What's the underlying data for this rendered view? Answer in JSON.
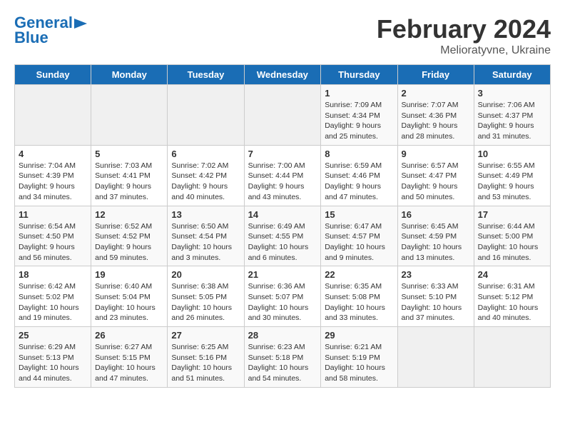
{
  "header": {
    "logo_line1": "General",
    "logo_line2": "Blue",
    "main_title": "February 2024",
    "sub_title": "Melioratyvne, Ukraine"
  },
  "columns": [
    "Sunday",
    "Monday",
    "Tuesday",
    "Wednesday",
    "Thursday",
    "Friday",
    "Saturday"
  ],
  "weeks": [
    [
      {
        "day": "",
        "content": ""
      },
      {
        "day": "",
        "content": ""
      },
      {
        "day": "",
        "content": ""
      },
      {
        "day": "",
        "content": ""
      },
      {
        "day": "1",
        "content": "Sunrise: 7:09 AM\nSunset: 4:34 PM\nDaylight: 9 hours\nand 25 minutes."
      },
      {
        "day": "2",
        "content": "Sunrise: 7:07 AM\nSunset: 4:36 PM\nDaylight: 9 hours\nand 28 minutes."
      },
      {
        "day": "3",
        "content": "Sunrise: 7:06 AM\nSunset: 4:37 PM\nDaylight: 9 hours\nand 31 minutes."
      }
    ],
    [
      {
        "day": "4",
        "content": "Sunrise: 7:04 AM\nSunset: 4:39 PM\nDaylight: 9 hours\nand 34 minutes."
      },
      {
        "day": "5",
        "content": "Sunrise: 7:03 AM\nSunset: 4:41 PM\nDaylight: 9 hours\nand 37 minutes."
      },
      {
        "day": "6",
        "content": "Sunrise: 7:02 AM\nSunset: 4:42 PM\nDaylight: 9 hours\nand 40 minutes."
      },
      {
        "day": "7",
        "content": "Sunrise: 7:00 AM\nSunset: 4:44 PM\nDaylight: 9 hours\nand 43 minutes."
      },
      {
        "day": "8",
        "content": "Sunrise: 6:59 AM\nSunset: 4:46 PM\nDaylight: 9 hours\nand 47 minutes."
      },
      {
        "day": "9",
        "content": "Sunrise: 6:57 AM\nSunset: 4:47 PM\nDaylight: 9 hours\nand 50 minutes."
      },
      {
        "day": "10",
        "content": "Sunrise: 6:55 AM\nSunset: 4:49 PM\nDaylight: 9 hours\nand 53 minutes."
      }
    ],
    [
      {
        "day": "11",
        "content": "Sunrise: 6:54 AM\nSunset: 4:50 PM\nDaylight: 9 hours\nand 56 minutes."
      },
      {
        "day": "12",
        "content": "Sunrise: 6:52 AM\nSunset: 4:52 PM\nDaylight: 9 hours\nand 59 minutes."
      },
      {
        "day": "13",
        "content": "Sunrise: 6:50 AM\nSunset: 4:54 PM\nDaylight: 10 hours\nand 3 minutes."
      },
      {
        "day": "14",
        "content": "Sunrise: 6:49 AM\nSunset: 4:55 PM\nDaylight: 10 hours\nand 6 minutes."
      },
      {
        "day": "15",
        "content": "Sunrise: 6:47 AM\nSunset: 4:57 PM\nDaylight: 10 hours\nand 9 minutes."
      },
      {
        "day": "16",
        "content": "Sunrise: 6:45 AM\nSunset: 4:59 PM\nDaylight: 10 hours\nand 13 minutes."
      },
      {
        "day": "17",
        "content": "Sunrise: 6:44 AM\nSunset: 5:00 PM\nDaylight: 10 hours\nand 16 minutes."
      }
    ],
    [
      {
        "day": "18",
        "content": "Sunrise: 6:42 AM\nSunset: 5:02 PM\nDaylight: 10 hours\nand 19 minutes."
      },
      {
        "day": "19",
        "content": "Sunrise: 6:40 AM\nSunset: 5:04 PM\nDaylight: 10 hours\nand 23 minutes."
      },
      {
        "day": "20",
        "content": "Sunrise: 6:38 AM\nSunset: 5:05 PM\nDaylight: 10 hours\nand 26 minutes."
      },
      {
        "day": "21",
        "content": "Sunrise: 6:36 AM\nSunset: 5:07 PM\nDaylight: 10 hours\nand 30 minutes."
      },
      {
        "day": "22",
        "content": "Sunrise: 6:35 AM\nSunset: 5:08 PM\nDaylight: 10 hours\nand 33 minutes."
      },
      {
        "day": "23",
        "content": "Sunrise: 6:33 AM\nSunset: 5:10 PM\nDaylight: 10 hours\nand 37 minutes."
      },
      {
        "day": "24",
        "content": "Sunrise: 6:31 AM\nSunset: 5:12 PM\nDaylight: 10 hours\nand 40 minutes."
      }
    ],
    [
      {
        "day": "25",
        "content": "Sunrise: 6:29 AM\nSunset: 5:13 PM\nDaylight: 10 hours\nand 44 minutes."
      },
      {
        "day": "26",
        "content": "Sunrise: 6:27 AM\nSunset: 5:15 PM\nDaylight: 10 hours\nand 47 minutes."
      },
      {
        "day": "27",
        "content": "Sunrise: 6:25 AM\nSunset: 5:16 PM\nDaylight: 10 hours\nand 51 minutes."
      },
      {
        "day": "28",
        "content": "Sunrise: 6:23 AM\nSunset: 5:18 PM\nDaylight: 10 hours\nand 54 minutes."
      },
      {
        "day": "29",
        "content": "Sunrise: 6:21 AM\nSunset: 5:19 PM\nDaylight: 10 hours\nand 58 minutes."
      },
      {
        "day": "",
        "content": ""
      },
      {
        "day": "",
        "content": ""
      }
    ]
  ]
}
